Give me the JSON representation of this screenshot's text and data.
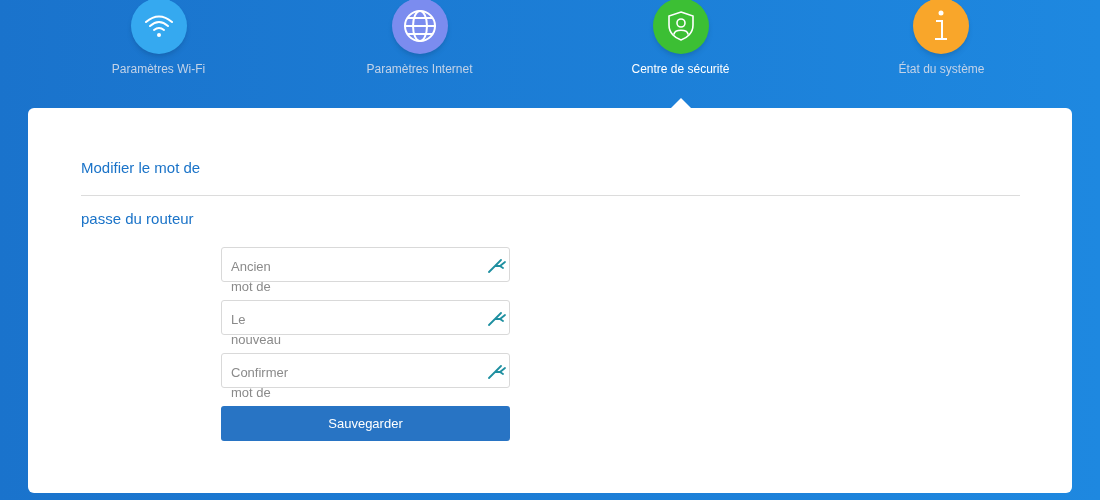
{
  "nav": [
    {
      "label": "Paramètres Wi-Fi",
      "kind": "wifi",
      "color": "#35a9f0",
      "selected": false
    },
    {
      "label": "Paramètres Internet",
      "kind": "globe",
      "color": "#7b8cef",
      "selected": false
    },
    {
      "label": "Centre de sécurité",
      "kind": "shield",
      "color": "#3cbf34",
      "selected": true
    },
    {
      "label": "État du système",
      "kind": "info",
      "color": "#f9a62a",
      "selected": false
    }
  ],
  "card": {
    "title": "Modifier le mot de passe du routeur",
    "fields": [
      {
        "placeholder": "Ancien",
        "overflow_text": "mot de"
      },
      {
        "placeholder": "Le",
        "overflow_text": "nouveau"
      },
      {
        "placeholder": "Confirmer",
        "overflow_text": "mot de"
      }
    ],
    "save_button": "Sauvegarder"
  }
}
